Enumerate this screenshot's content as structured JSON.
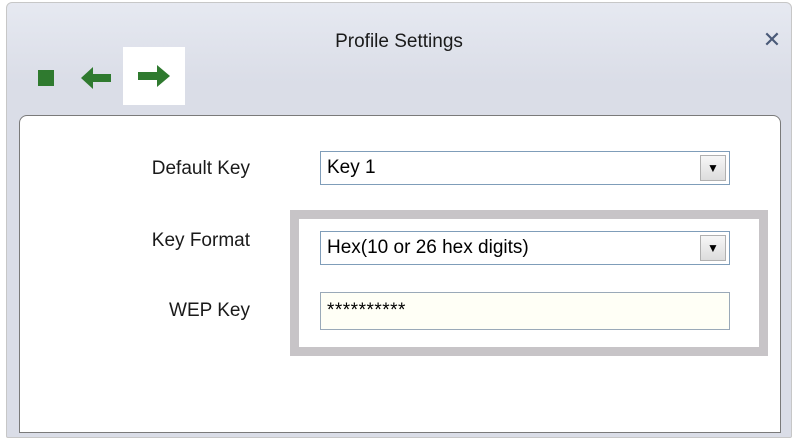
{
  "window": {
    "title": "Profile Settings",
    "close_glyph": "✕"
  },
  "toolbar": {
    "stop_icon": "stop-icon",
    "back_icon": "arrow-left-icon",
    "next_icon": "arrow-right-icon",
    "icon_color": "#2f7a2f",
    "selected_highlight": "#ffffff"
  },
  "form": {
    "default_key_label": "Default Key",
    "default_key_value": "Key 1",
    "key_format_label": "Key Format",
    "key_format_value": "Hex(10 or 26 hex digits)",
    "wep_key_label": "WEP Key",
    "wep_key_value": "**********",
    "dropdown_arrow_glyph": "▼",
    "highlight_color": "#c7c4c7"
  }
}
